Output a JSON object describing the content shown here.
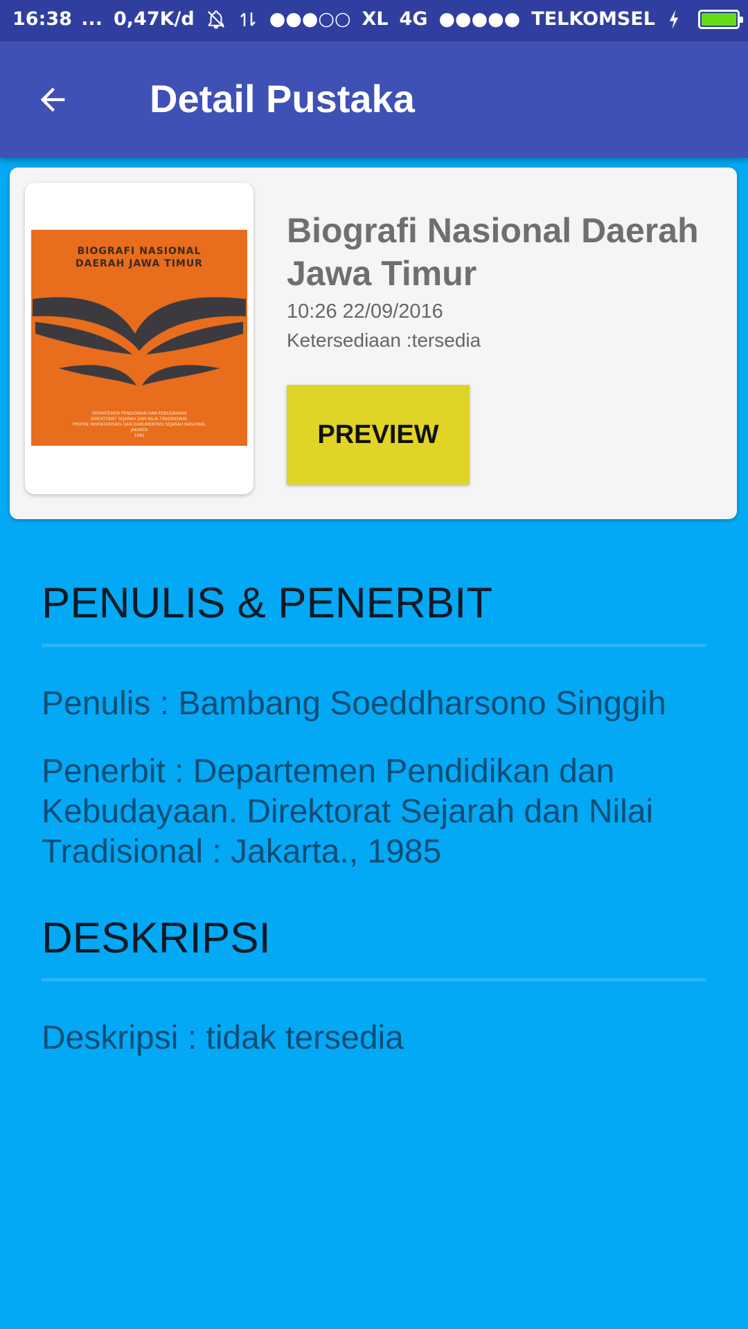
{
  "status_bar": {
    "time": "16:38",
    "dots": "...",
    "speed": "0,47K/d",
    "signal_1": "●●●○○",
    "carrier_1": "XL",
    "network": "4G",
    "signal_2": "●●●●●",
    "carrier_2": "TELKOMSEL",
    "battery_level": 1.0,
    "battery_color": "#64dd17"
  },
  "app_bar": {
    "title": "Detail Pustaka",
    "back_icon": "arrow-back-icon"
  },
  "book": {
    "cover": {
      "line1": "BIOGRAFI NASIONAL",
      "line2": "DAERAH JAWA TIMUR",
      "foot1": "DEPARTEMEN PENDIDIKAN DAN KEBUDAYAAN",
      "foot2": "DIREKTORAT SEJARAH DAN NILAI TRADISIONAL",
      "foot3": "PROYEK INVENTARISASI DAN DOKUMENTASI SEJARAH NASIONAL",
      "foot4": "JAKARTA",
      "foot5": "1985"
    },
    "title": "Biografi Nasional Daerah Jawa Timur",
    "date": "10:26 22/09/2016",
    "availability": "Ketersediaan :tersedia",
    "preview_label": "PREVIEW"
  },
  "author_section": {
    "heading": "PENULIS & PENERBIT",
    "author": "Penulis : Bambang Soeddharsono Singgih",
    "publisher": "Penerbit : Departemen Pendidikan dan Kebudayaan. Direktorat Sejarah dan Nilai Tradisional : Jakarta., 1985"
  },
  "description_section": {
    "heading": "DESKRIPSI",
    "description": "Deskripsi : tidak tersedia"
  },
  "colors": {
    "status_bar": "#303f9f",
    "app_bar": "#3f51b5",
    "background": "#03a9f4",
    "preview_button": "#e0d426",
    "divider": "#29b6f6"
  }
}
